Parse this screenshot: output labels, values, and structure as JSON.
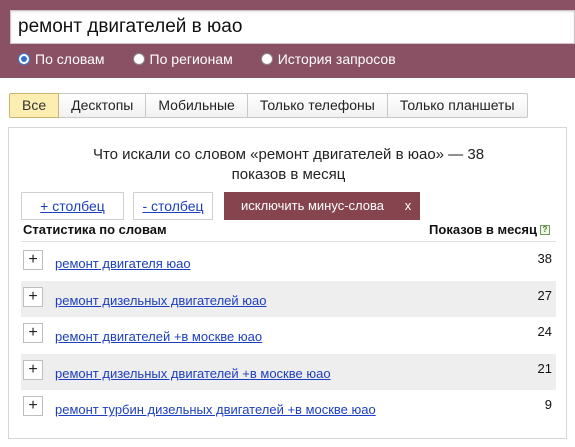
{
  "search": {
    "query": "ремонт двигателей в юао"
  },
  "modes": [
    {
      "label": "По словам",
      "checked": true
    },
    {
      "label": "По регионам",
      "checked": false
    },
    {
      "label": "История запросов",
      "checked": false
    }
  ],
  "device_tabs": [
    {
      "label": "Все",
      "active": true
    },
    {
      "label": "Десктопы",
      "active": false
    },
    {
      "label": "Мобильные",
      "active": false
    },
    {
      "label": "Только телефоны",
      "active": false
    },
    {
      "label": "Только планшеты",
      "active": false
    }
  ],
  "panel": {
    "title_line1": "Что искали со словом «ремонт двигателей в юао» — 38",
    "title_line2": "показов в месяц",
    "add_column": "+ столбец",
    "remove_column": "- столбец",
    "exclude_minus": "исключить минус-слова",
    "close": "x",
    "col_left": "Статистика по словам",
    "col_right": "Показов в месяц",
    "help": "?"
  },
  "rows": [
    {
      "keyword": "ремонт двигателя юао",
      "count": "38"
    },
    {
      "keyword": "ремонт дизельных двигателей юао",
      "count": "27"
    },
    {
      "keyword": "ремонт двигателей +в москве юао",
      "count": "24"
    },
    {
      "keyword": "ремонт дизельных двигателей +в москве юао",
      "count": "21"
    },
    {
      "keyword": "ремонт турбин дизельных двигателей +в москве юао",
      "count": "9"
    }
  ],
  "colors": {
    "header_bg": "#8a5064",
    "active_tab": "#fbeeb0",
    "accent_button": "#86454e",
    "link": "#1d3fbf"
  }
}
